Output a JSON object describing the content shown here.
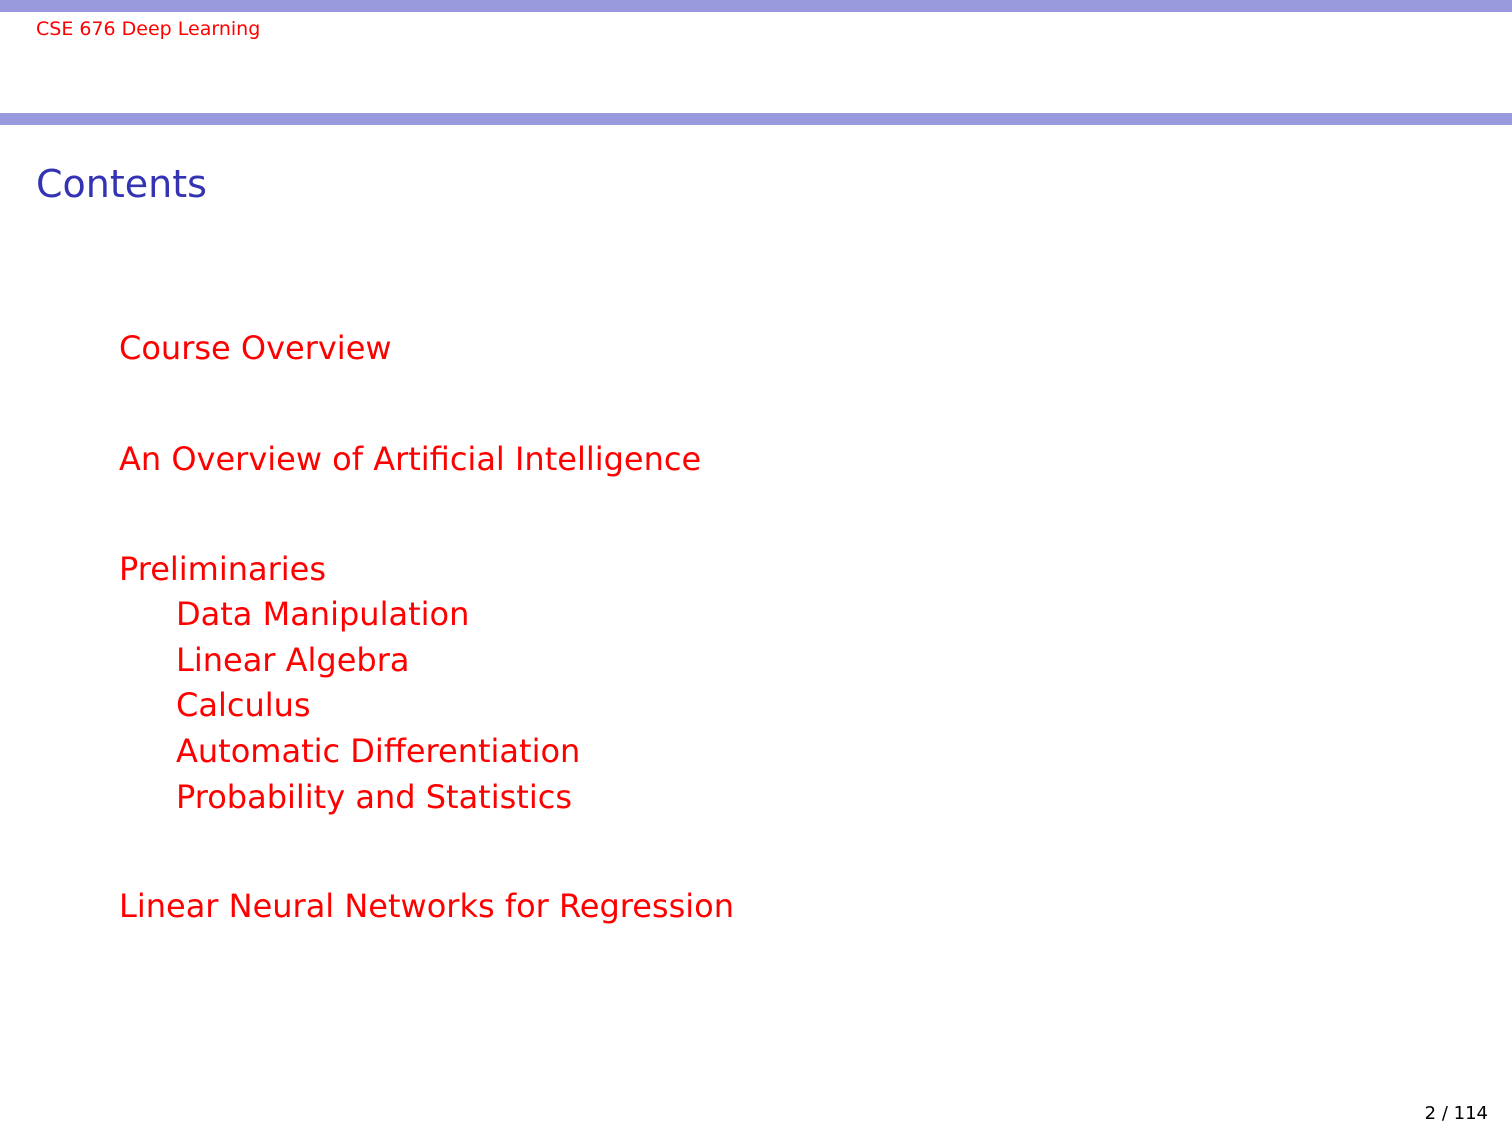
{
  "header": {
    "title": "CSE 676 Deep Learning"
  },
  "frame": {
    "title": "Contents"
  },
  "toc": {
    "sections": [
      {
        "label": "Course Overview"
      },
      {
        "label": "An Overview of Artificial Intelligence"
      },
      {
        "label": "Preliminaries",
        "subsections": [
          "Data Manipulation",
          "Linear Algebra",
          "Calculus",
          "Automatic Differentiation",
          "Probability and Statistics"
        ]
      },
      {
        "label": "Linear Neural Networks for Regression"
      }
    ]
  },
  "footer": {
    "page_number": "2 / 114"
  },
  "colors": {
    "bar": "#9999dd",
    "title": "#3333b3",
    "link": "#ff0000"
  }
}
